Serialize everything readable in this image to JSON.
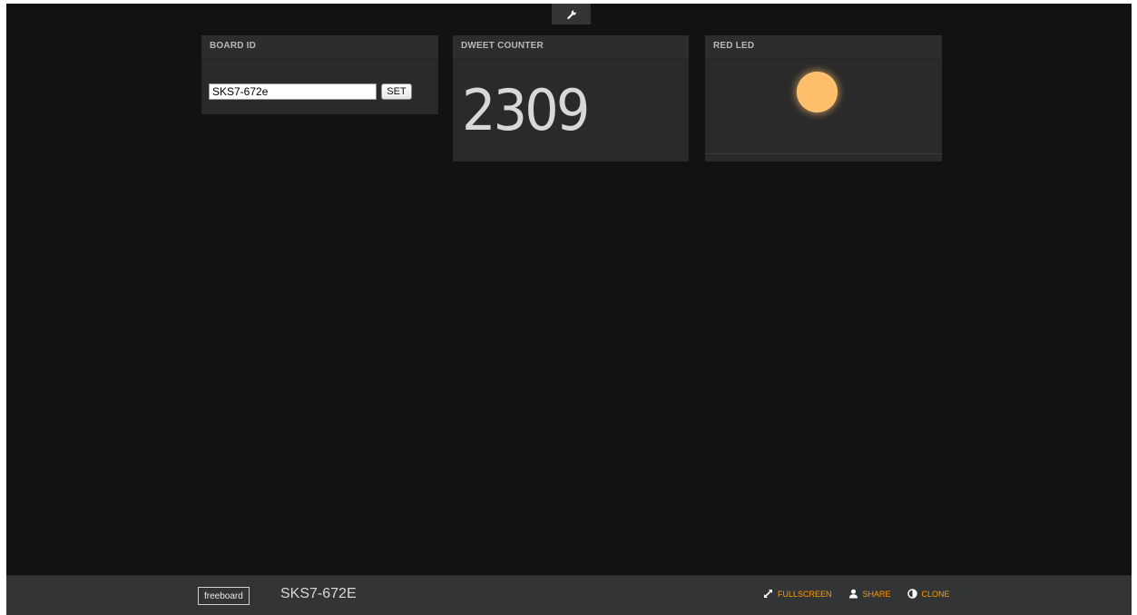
{
  "panes": {
    "board_id": {
      "title": "BOARD ID",
      "input_value": "SKS7-672e",
      "set_label": "SET"
    },
    "dweet_counter": {
      "title": "DWEET COUNTER",
      "value": "2309"
    },
    "red_led": {
      "title": "RED LED",
      "led_state": "on",
      "led_color": "#ffbf6a"
    }
  },
  "header": {
    "settings_icon": "wrench-icon"
  },
  "footer": {
    "logo": "freeboard",
    "dashboard_title": "SKS7-672E",
    "actions": {
      "fullscreen": "FULLSCREEN",
      "share": "SHARE",
      "clone": "CLONE"
    },
    "accent_color": "#ff9900"
  }
}
